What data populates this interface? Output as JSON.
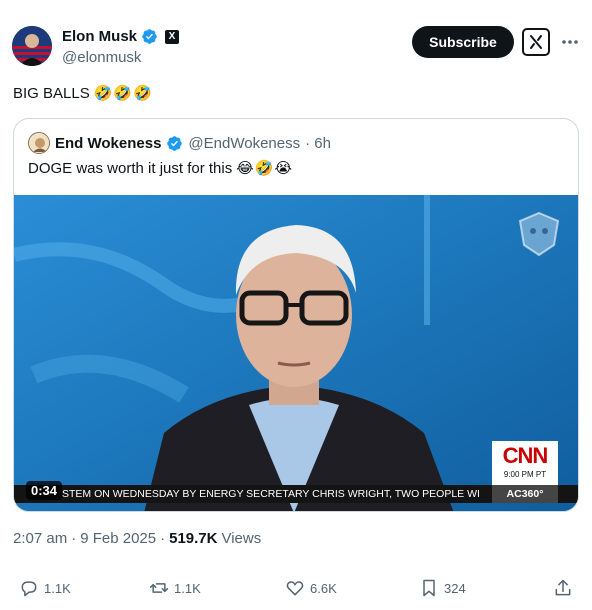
{
  "author": {
    "name": "Elon Musk",
    "handle": "@elonmusk",
    "verified_color": "#1d9bf0",
    "affiliate_badge": "X"
  },
  "header": {
    "subscribe_label": "Subscribe",
    "grok_icon": "grok-icon",
    "more_icon": "more-icon"
  },
  "post": {
    "text": "BIG BALLS",
    "emojis": [
      "🤣",
      "🤣",
      "🤣"
    ]
  },
  "quote": {
    "name": "End Wokeness",
    "handle": "@EndWokeness",
    "time": "· 6h",
    "text": "DOGE was worth it just for this",
    "emojis": [
      "😂",
      "🤣",
      "😭"
    ],
    "video": {
      "duration": "0:34",
      "ticker": "STEM ON WEDNESDAY BY ENERGY SECRETARY CHRIS WRIGHT, TWO PEOPLE WI",
      "ticker_tag": "AC360°",
      "network": "CNN",
      "network_time": "9:00 PM PT"
    }
  },
  "meta": {
    "time": "2:07 am",
    "date": "9 Feb 2025",
    "separator": "·",
    "views_count": "519.7K",
    "views_label": "Views"
  },
  "actions": {
    "replies": "1.1K",
    "reposts": "1.1K",
    "likes": "6.6K",
    "bookmarks": "324"
  },
  "colors": {
    "text": "#0f1419",
    "secondary": "#536471",
    "border": "#cfd9de",
    "accent": "#1d9bf0",
    "cnn_red": "#cc0000"
  }
}
